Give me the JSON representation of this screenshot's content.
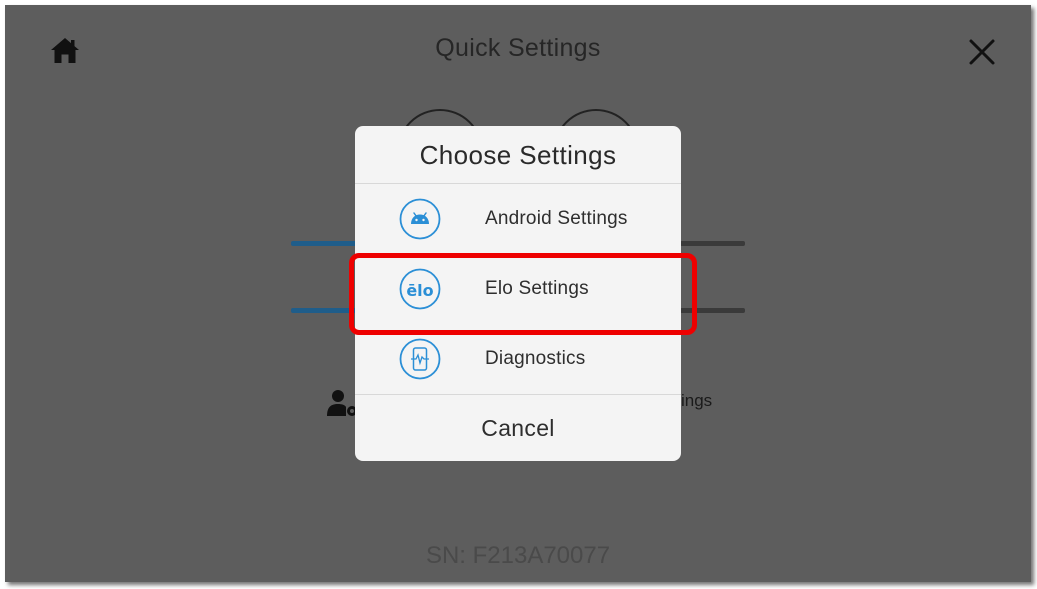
{
  "screen": {
    "title": "Quick Settings",
    "serial": "SN: F213A70077",
    "partial_text": "ings",
    "overlay_color": "#5d5d5d"
  },
  "icons": {
    "home": "home-icon",
    "close": "close-icon",
    "user_settings": "user-gear-icon"
  },
  "dialog": {
    "title": "Choose Settings",
    "options": [
      {
        "label": "Android Settings",
        "icon": "android-icon"
      },
      {
        "label": "Elo Settings",
        "icon": "elo-logo-icon",
        "highlighted": true
      },
      {
        "label": "Diagnostics",
        "icon": "phone-diagnostics-icon"
      }
    ],
    "cancel_label": "Cancel",
    "icon_color": "#2b8fd6"
  },
  "elo_logo_text": "ēlo",
  "highlight_color": "#ee0000"
}
